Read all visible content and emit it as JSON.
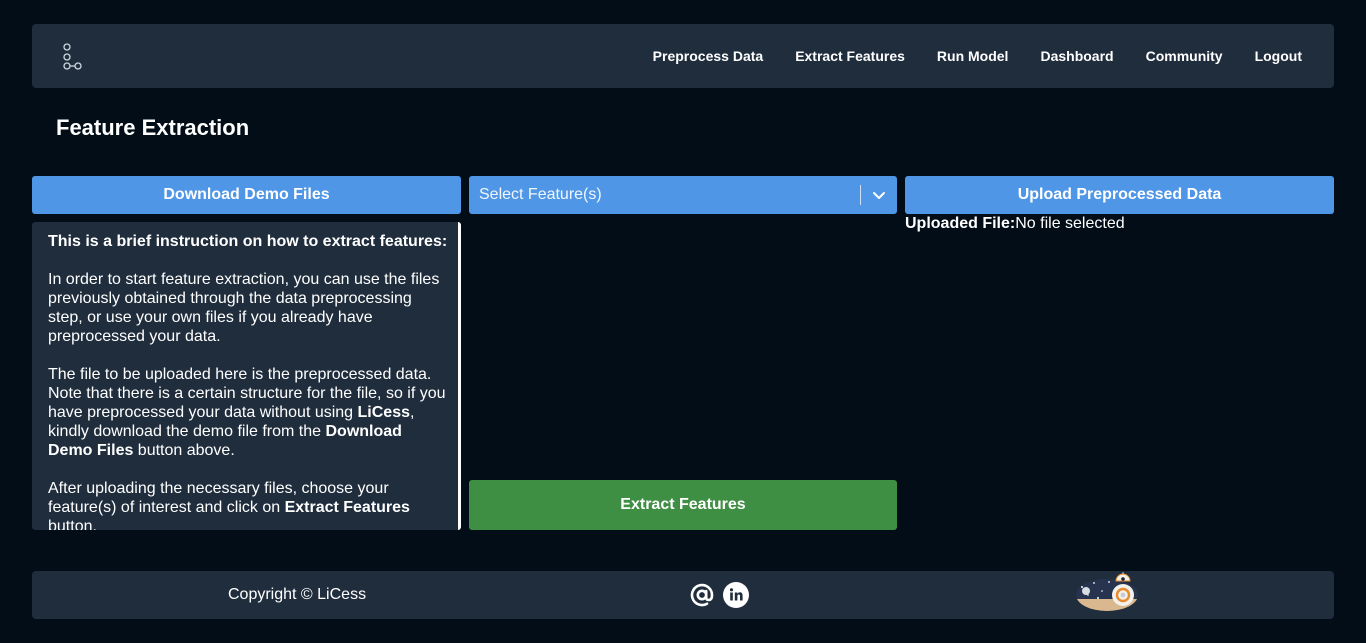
{
  "nav": {
    "items": [
      {
        "label": "Preprocess Data"
      },
      {
        "label": "Extract Features"
      },
      {
        "label": "Run Model"
      },
      {
        "label": "Dashboard"
      },
      {
        "label": "Community"
      },
      {
        "label": "Logout"
      }
    ]
  },
  "page_title": "Feature Extraction",
  "download_button": "Download Demo Files",
  "feature_select": {
    "placeholder": "Select Feature(s)"
  },
  "upload_button": "Upload Preprocessed Data",
  "uploaded_file": {
    "label": "Uploaded File:",
    "value": "No file selected"
  },
  "instructions": {
    "heading": "This is a brief instruction on how to extract features:",
    "p1": "In order to start feature extraction, you can use the files previously obtained through the data preprocessing step, or use your own files if you already have preprocessed your data.",
    "p2_a": "The file to be uploaded here is the preprocessed data. Note that there is a certain structure for the file, so if you have preprocessed your data without using ",
    "p2_b": "LiCess",
    "p2_c": ", kindly download the demo file from the ",
    "p2_d": "Download Demo Files",
    "p2_e": " button above.",
    "p3_a": "After uploading the necessary files, choose your feature(s) of interest and click on ",
    "p3_b": "Extract Features",
    "p3_c": " button."
  },
  "extract_button": "Extract Features",
  "footer": {
    "copyright": "Copyright © LiCess"
  },
  "colors": {
    "background": "#020d18",
    "panel": "#1f2d3d",
    "accent_blue": "#4f97e6",
    "accent_green": "#3e8e43"
  }
}
